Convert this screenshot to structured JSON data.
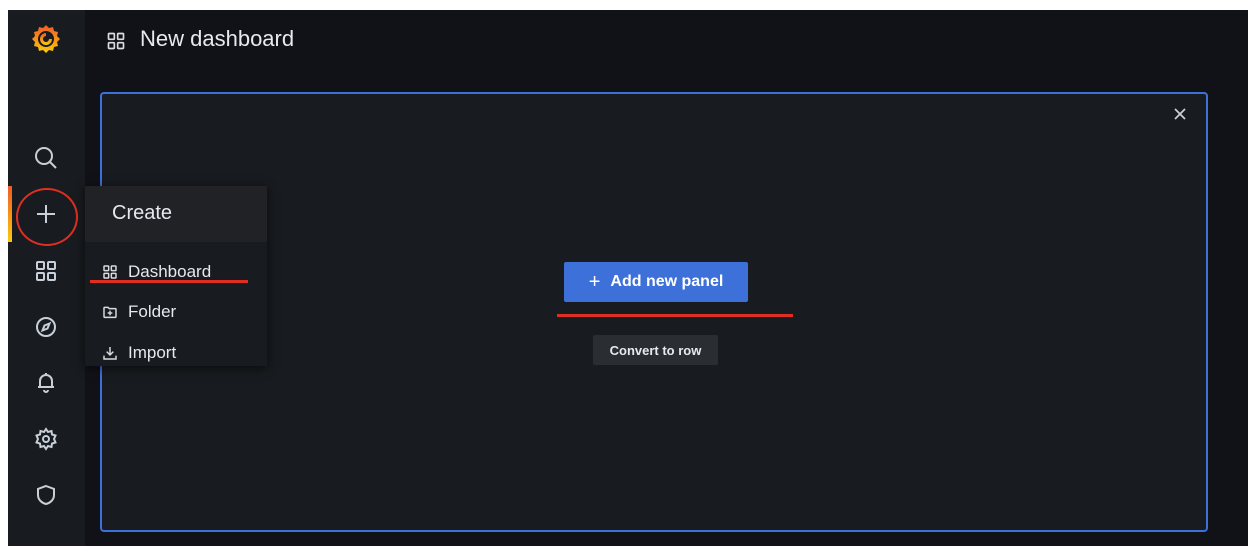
{
  "header": {
    "title": "New dashboard",
    "title_icon": "apps-grid-icon"
  },
  "sidebar": {
    "logo": "grafana-logo",
    "items": [
      {
        "name": "search",
        "icon": "search-icon"
      },
      {
        "name": "create",
        "icon": "plus-icon",
        "active": true
      },
      {
        "name": "dashboards",
        "icon": "apps-grid-icon"
      },
      {
        "name": "explore",
        "icon": "compass-icon"
      },
      {
        "name": "alerting",
        "icon": "bell-icon"
      },
      {
        "name": "configuration",
        "icon": "gear-icon"
      },
      {
        "name": "server-admin",
        "icon": "shield-icon"
      }
    ]
  },
  "create_menu": {
    "title": "Create",
    "items": [
      {
        "label": "Dashboard",
        "icon": "apps-grid-icon"
      },
      {
        "label": "Folder",
        "icon": "folder-plus-icon"
      },
      {
        "label": "Import",
        "icon": "import-icon"
      }
    ]
  },
  "panel": {
    "add_panel_label": "Add new panel",
    "add_panel_icon": "plus",
    "convert_label": "Convert to row",
    "close_icon": "close-icon"
  },
  "colors": {
    "background": "#111217",
    "sidebar": "#181b1f",
    "panel_border": "#3d71d9",
    "primary_button": "#3d71d9",
    "annotation_red": "#e02f22",
    "active_gradient_start": "#f05a28",
    "active_gradient_end": "#fbca0a"
  }
}
